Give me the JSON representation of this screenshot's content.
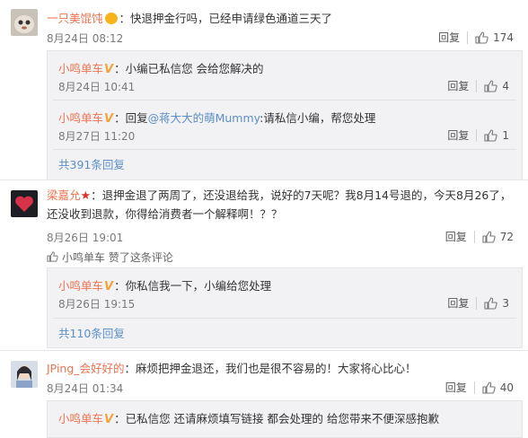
{
  "comments": [
    {
      "user": "一只美馄饨",
      "text": "：快退押金行吗，已经申请绿色通道三天了",
      "time": "8月24日 08:12",
      "reply_label": "回复",
      "likes": "174",
      "replies": [
        {
          "user": "小鸣单车",
          "text": "：小编已私信您 会给您解决的",
          "time": "8月24日 10:41",
          "reply_label": "回复",
          "likes": "4"
        },
        {
          "user": "小鸣单车",
          "text_prefix": "：回复",
          "mention": "@蒋大大的萌Mummy",
          "text": ":请私信小编，帮您处理",
          "time": "8月27日 11:20",
          "reply_label": "回复",
          "likes": "1"
        }
      ],
      "more": "共391条回复"
    },
    {
      "user": "梁嘉允",
      "text": "：退押金退了两周了，还没退给我，说好的7天呢？我8月14号退的，今天8月26了，还没收到退款，你得给消费者一个解释啊！？？",
      "time": "8月26日 19:01",
      "reply_label": "回复",
      "likes": "72",
      "liked_by_user": "小鸣单车",
      "liked_by_text": " 赞了这条评论",
      "replies": [
        {
          "user": "小鸣单车",
          "text": "：你私信我一下，小编给您处理",
          "time": "8月26日 19:15",
          "reply_label": "回复",
          "likes": "3"
        }
      ],
      "more": "共110条回复"
    },
    {
      "user": "JPing_会好好的",
      "text": "：麻烦把押金退还，我们也是很不容易的！大家将心比心！",
      "time": "8月24日 01:34",
      "reply_label": "回复",
      "likes": "40",
      "replies": [
        {
          "user": "小鸣单车",
          "text": "：已私信您 还请麻烦填写链接 都会处理的 给您带来不便深感抱歉"
        }
      ]
    }
  ]
}
